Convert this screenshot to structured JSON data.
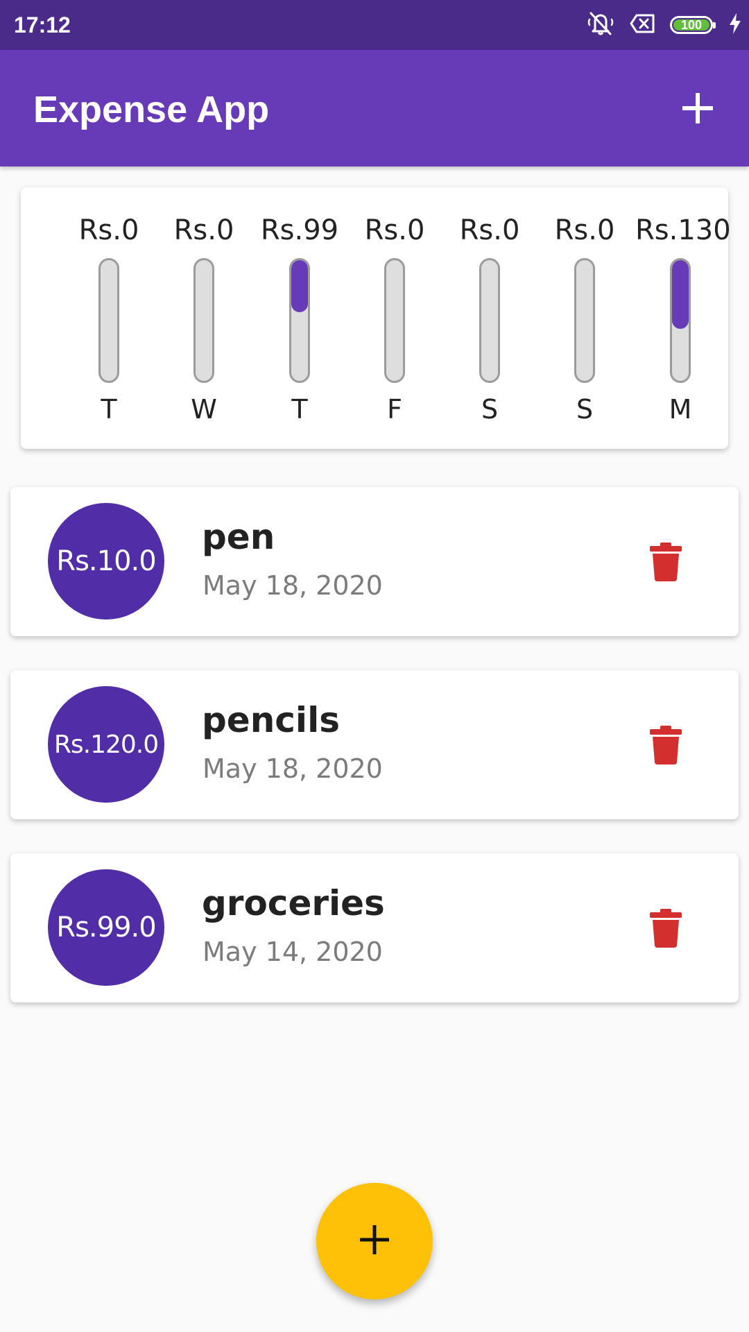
{
  "status_bar": {
    "time": "17:12",
    "battery_level": "100",
    "icons": [
      "mute-bell-icon",
      "no-sim-icon",
      "battery-icon",
      "charging-bolt-icon"
    ]
  },
  "app_bar": {
    "title": "Expense App",
    "add_icon": "plus-icon"
  },
  "chart_data": {
    "type": "bar",
    "categories": [
      "T",
      "W",
      "T",
      "F",
      "S",
      "S",
      "M"
    ],
    "value_labels": [
      "Rs.0",
      "Rs.0",
      "Rs.99",
      "Rs.0",
      "Rs.0",
      "Rs.0",
      "Rs.130"
    ],
    "values": [
      0,
      0,
      99,
      0,
      0,
      0,
      130
    ],
    "fill_fractions": [
      0,
      0,
      0.43,
      0,
      0,
      0,
      0.57
    ],
    "bar_color": "#673ab7",
    "track_color": "#dedede"
  },
  "transactions": [
    {
      "amount": "Rs.10.0",
      "title": "pen",
      "date": "May 18, 2020"
    },
    {
      "amount": "Rs.120.0",
      "title": "pencils",
      "date": "May 18, 2020"
    },
    {
      "amount": "Rs.99.0",
      "title": "groceries",
      "date": "May 14, 2020"
    }
  ],
  "colors": {
    "primary": "#673ab7",
    "status_bar": "#4a2b8a",
    "avatar": "#512da8",
    "delete": "#d32f2f",
    "fab": "#ffc107"
  },
  "fab": {
    "icon": "plus-icon"
  }
}
